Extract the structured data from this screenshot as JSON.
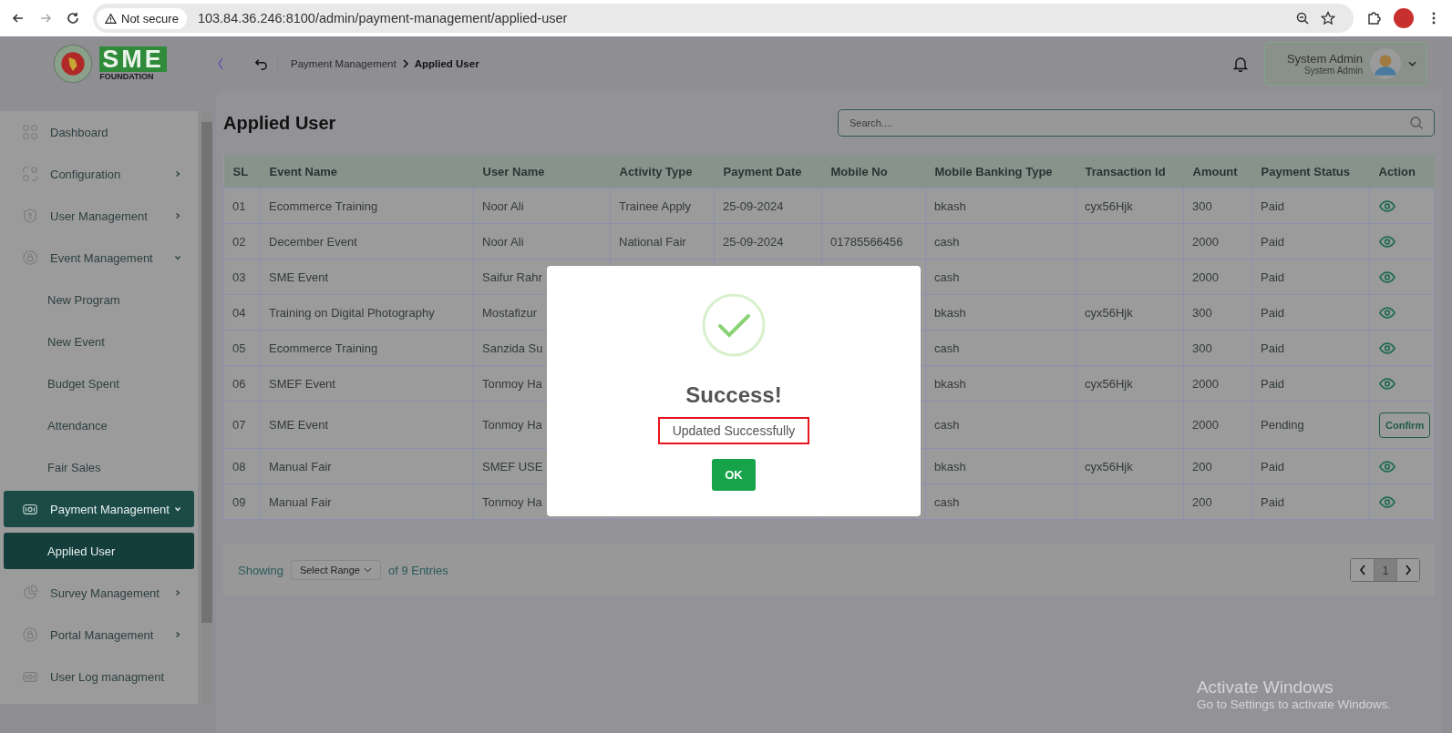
{
  "browser": {
    "security": "Not secure",
    "url": "103.84.36.246:8100/admin/payment-management/applied-user"
  },
  "logo": {
    "text": "SME",
    "subtitle": "FOUNDATION"
  },
  "breadcrumb": [
    "Payment Management",
    "Applied User"
  ],
  "user": {
    "name": "System Admin",
    "role": "System Admin"
  },
  "sidebar": {
    "items": [
      {
        "label": "Dashboard",
        "selected": false
      },
      {
        "label": "Configuration",
        "expanded": false,
        "selected": false
      },
      {
        "label": "User Management",
        "expanded": false,
        "selected": false
      },
      {
        "label": "Event Management",
        "expanded": true,
        "selected": false,
        "children": [
          {
            "label": "New Program",
            "selected": false
          },
          {
            "label": "New Event",
            "selected": false
          },
          {
            "label": "Budget Spent",
            "selected": false
          },
          {
            "label": "Attendance",
            "selected": false
          },
          {
            "label": "Fair Sales",
            "selected": false
          }
        ]
      },
      {
        "label": "Payment Management",
        "expanded": true,
        "selected": true,
        "children": [
          {
            "label": "Applied User",
            "selected": true
          }
        ]
      },
      {
        "label": "Survey Management",
        "expanded": false,
        "selected": false
      },
      {
        "label": "Portal Management",
        "expanded": false,
        "selected": false
      },
      {
        "label": "User Log managment",
        "selected": false
      }
    ]
  },
  "page": {
    "title": "Applied User",
    "search": {
      "placeholder": "Search...."
    }
  },
  "table": {
    "columns": [
      "SL",
      "Event Name",
      "User Name",
      "Activity Type",
      "Payment Date",
      "Mobile No",
      "Mobile Banking Type",
      "Transaction Id",
      "Amount",
      "Payment Status",
      "Action"
    ],
    "rows": [
      {
        "sl": "01",
        "event": "Ecommerce Training",
        "user": "Noor Ali",
        "activity": "Trainee Apply",
        "date": "25-09-2024",
        "banking": "bkash",
        "txn": "cyx56Hjk",
        "amount": "300",
        "status": "Paid",
        "action": {
          "kind": "view"
        }
      },
      {
        "sl": "02",
        "event": "December Event",
        "user": "Noor Ali",
        "activity": "National Fair",
        "date": "25-09-2024",
        "mobile": "01785566456",
        "banking": "cash",
        "amount": "2000",
        "status": "Paid",
        "action": {
          "kind": "view"
        }
      },
      {
        "sl": "03",
        "event": "SME Event",
        "user": "Saifur Rahr",
        "banking": "cash",
        "amount": "2000",
        "status": "Paid",
        "action": {
          "kind": "view"
        }
      },
      {
        "sl": "04",
        "event": "Training on Digital Photography",
        "user": "Mostafizur",
        "banking": "bkash",
        "txn": "cyx56Hjk",
        "amount": "300",
        "status": "Paid",
        "action": {
          "kind": "view"
        }
      },
      {
        "sl": "05",
        "event": "Ecommerce Training",
        "user": "Sanzida Su",
        "banking": "cash",
        "amount": "300",
        "status": "Paid",
        "action": {
          "kind": "view"
        }
      },
      {
        "sl": "06",
        "event": "SMEF Event",
        "user": "Tonmoy Ha",
        "banking": "bkash",
        "txn": "cyx56Hjk",
        "amount": "2000",
        "status": "Paid",
        "action": {
          "kind": "view"
        }
      },
      {
        "sl": "07",
        "event": "SME Event",
        "user": "Tonmoy Ha",
        "banking": "cash",
        "amount": "2000",
        "status": "Pending",
        "action": {
          "kind": "confirm",
          "label": "Confirm"
        }
      },
      {
        "sl": "08",
        "event": "Manual Fair",
        "user": "SMEF USE",
        "banking": "bkash",
        "txn": "cyx56Hjk",
        "amount": "200",
        "status": "Paid",
        "action": {
          "kind": "view"
        }
      },
      {
        "sl": "09",
        "event": "Manual Fair",
        "user": "Tonmoy Ha",
        "banking": "cash",
        "amount": "200",
        "status": "Paid",
        "action": {
          "kind": "view"
        }
      }
    ]
  },
  "pagination": {
    "showing": "Showing",
    "range": "Select Range",
    "entries": "of 9 Entries",
    "pages": [
      {
        "label": "1",
        "selected": true
      }
    ]
  },
  "modal": {
    "title": "Success!",
    "message": "Updated Successfully",
    "button": "OK"
  },
  "os_notice": {
    "title": "Activate Windows",
    "subtitle": "Go to Settings to activate Windows."
  }
}
